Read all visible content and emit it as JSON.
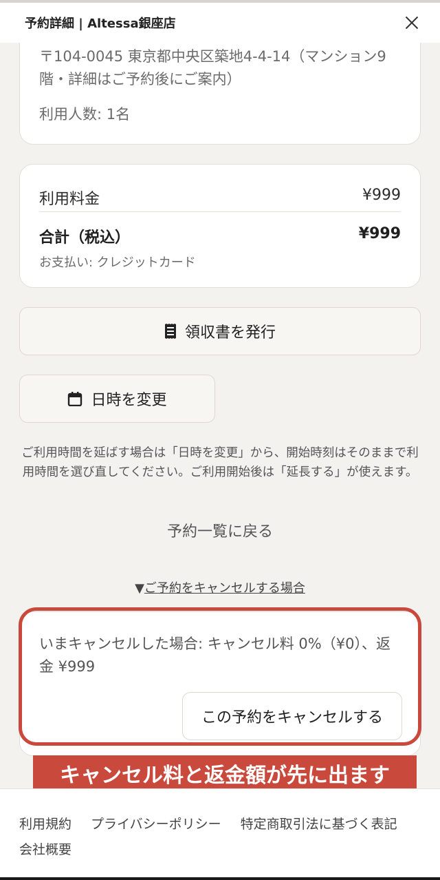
{
  "header": {
    "title": "予約詳細 | Altessa銀座店",
    "close_icon": "close-icon"
  },
  "address_card": {
    "address": "〒104-0045 東京都中央区築地4-4-14（マンション9階・詳細はご予約後にご案内）",
    "people": "利用人数: 1名"
  },
  "price_card": {
    "fee_label": "利用料金",
    "fee_value": "¥999",
    "total_label": "合計（税込）",
    "total_value": "¥999",
    "payment": "お支払い: クレジットカード"
  },
  "buttons": {
    "receipt_label": "領収書を発行",
    "receipt_icon": "receipt-icon",
    "change_label": "日時を変更",
    "change_icon": "calendar-icon"
  },
  "notice": "ご利用時間を延ばす場合は「日時を変更」から、開始時刻はそのままで利用時間を選び直してください。ご利用開始後は「延長する」が使えます。",
  "back_link": "予約一覧に戻る",
  "cancel_section": {
    "toggle_arrow": "▼",
    "toggle_label": "ご予約をキャンセルする場合",
    "info": "いまキャンセルした場合: キャンセル料 0%（¥0）、返金 ¥999",
    "cancel_button": "この予約をキャンセルする"
  },
  "annotation": {
    "banner": "キャンセル料と返金額が先に出ます",
    "color": "#c94a3c"
  },
  "footer": {
    "links": [
      "利用規約",
      "プライバシーポリシー",
      "特定商取引法に基づく表記",
      "会社概要"
    ]
  }
}
